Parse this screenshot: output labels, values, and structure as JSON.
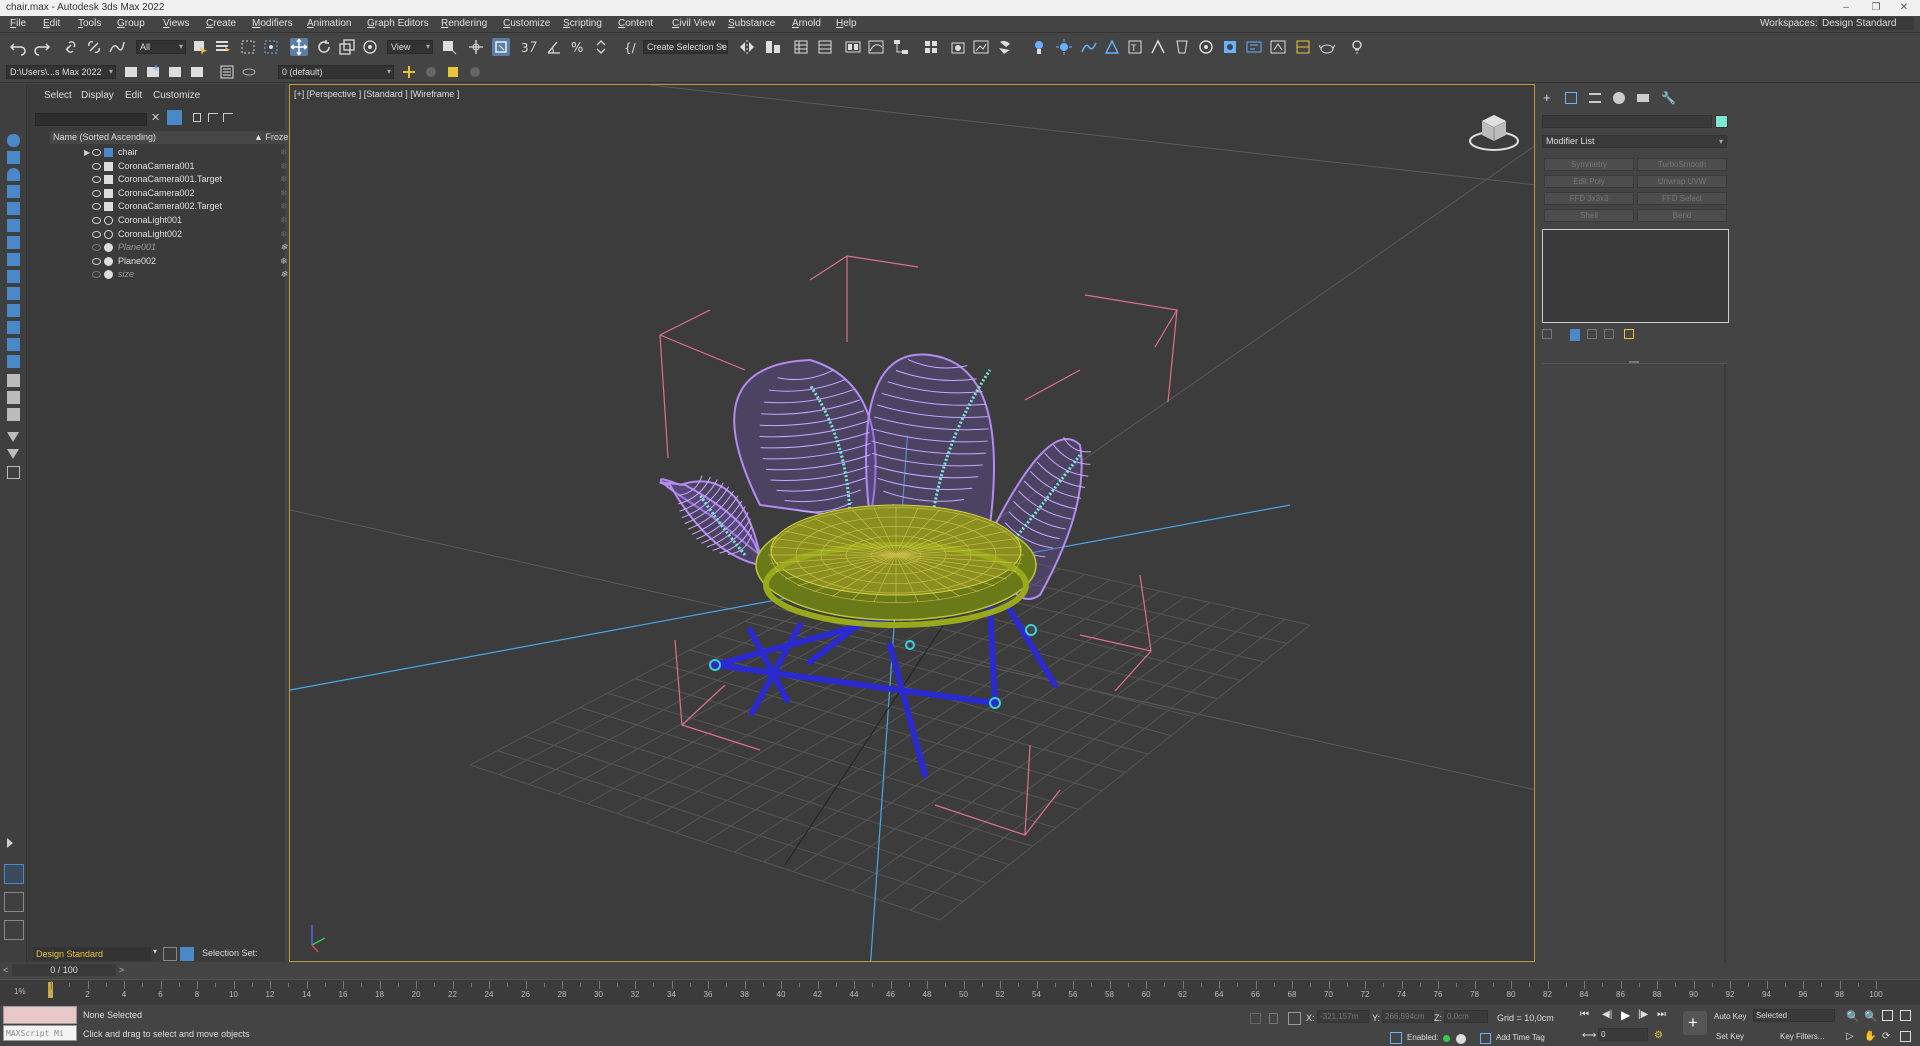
{
  "window": {
    "title": "chair.max - Autodesk 3ds Max 2022"
  },
  "menu": [
    "File",
    "Edit",
    "Tools",
    "Group",
    "Views",
    "Create",
    "Modifiers",
    "Animation",
    "Graph Editors",
    "Rendering",
    "Customize",
    "Scripting",
    "Content",
    "Civil View",
    "Substance",
    "Arnold",
    "Help"
  ],
  "workspaces": {
    "label": "Workspaces:",
    "value": "Design Standard"
  },
  "toolbar": {
    "selection_filter": "All",
    "ref_coord": "View",
    "named_selection": "Create Selection Se",
    "project_path": "D:\\Users\\...s Max 2022",
    "layer": "0 (default)"
  },
  "explorer": {
    "tabs": [
      "Select",
      "Display",
      "Edit",
      "Customize"
    ],
    "header_name": "Name (Sorted Ascending)",
    "header_frozen": "▲ Frozen",
    "rows": [
      {
        "name": "chair",
        "type": "group",
        "hidden": false
      },
      {
        "name": "CoronaCamera001",
        "type": "camera",
        "hidden": false
      },
      {
        "name": "CoronaCamera001.Target",
        "type": "camera",
        "hidden": false
      },
      {
        "name": "CoronaCamera002",
        "type": "camera",
        "hidden": false
      },
      {
        "name": "CoronaCamera002.Target",
        "type": "camera",
        "hidden": false
      },
      {
        "name": "CoronaLight001",
        "type": "light",
        "hidden": false
      },
      {
        "name": "CoronaLight002",
        "type": "light",
        "hidden": false
      },
      {
        "name": "Plane001",
        "type": "geometry",
        "hidden": true
      },
      {
        "name": "Plane002",
        "type": "geometry",
        "hidden": false
      },
      {
        "name": "size",
        "type": "geometry",
        "hidden": true
      }
    ],
    "workspace": "Design Standard",
    "selection_set_label": "Selection Set:"
  },
  "viewport": {
    "label": "[+] [Perspective ] [Standard ] [Wireframe ]",
    "colors": {
      "border": "#b89b3a",
      "camera_lines": "#e0708a",
      "chair_back": "#b48cf0",
      "chair_seat": "#9aa81c",
      "chair_legs": "#2a2ad0",
      "accent": "#7fe8d2"
    }
  },
  "command_panel": {
    "modifier_list": "Modifier List",
    "modifiers": [
      "Symmetry",
      "TurboSmooth",
      "Edit Poly",
      "Unwrap UVW",
      "FFD 3x3x3",
      "FFD Select",
      "Shell",
      "Bend"
    ]
  },
  "timeline": {
    "slider": "0 / 100",
    "ticks": [
      0,
      2,
      4,
      6,
      8,
      10,
      12,
      14,
      16,
      18,
      20,
      22,
      24,
      26,
      28,
      30,
      32,
      34,
      36,
      38,
      40,
      42,
      44,
      46,
      48,
      50,
      52,
      54,
      56,
      58,
      60,
      62,
      64,
      66,
      68,
      70,
      72,
      74,
      76,
      78,
      80,
      82,
      84,
      86,
      88,
      90,
      92,
      94,
      96,
      98,
      100
    ]
  },
  "status": {
    "maxscript": "MAXScript Mi",
    "selection": "None Selected",
    "prompt": "Click and drag to select and move objects",
    "x_label": "X:",
    "x_value": "-321,157m",
    "y_label": "Y:",
    "y_value": "266,594cm",
    "z_label": "Z:",
    "z_value": "0,0cm",
    "grid": "Grid = 10,0cm",
    "enabled_label": "Enabled:",
    "add_time_tag": "Add Time Tag",
    "auto_key": "Auto Key",
    "set_key": "Set Key",
    "selected": "Selected",
    "key_filters": "Key Filters...",
    "frame": "0"
  }
}
